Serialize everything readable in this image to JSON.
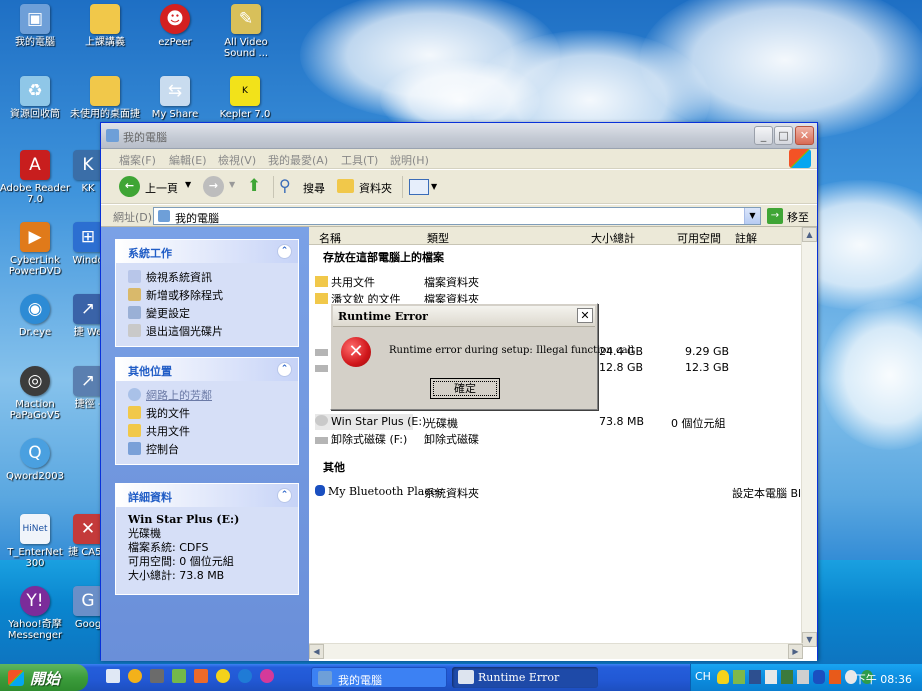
{
  "desktop": {
    "icons": [
      {
        "label": "我的電腦",
        "icon": "my-computer-icon"
      },
      {
        "label": "上課講義",
        "icon": "folder-icon"
      },
      {
        "label": "ezPeer",
        "icon": "ezpeer-icon"
      },
      {
        "label": "All Video Sound ...",
        "icon": "paint-brush-icon"
      },
      {
        "label": "資源回收筒",
        "icon": "recycle-bin-icon"
      },
      {
        "label": "未使用的桌面捷",
        "icon": "folder-icon"
      },
      {
        "label": "My Share",
        "icon": "my-share-icon"
      },
      {
        "label": "Kepler 7.0",
        "icon": "kepler-icon"
      },
      {
        "label": "Adobe Reader 7.0",
        "icon": "adobe-reader-icon"
      },
      {
        "label": "KK",
        "icon": "kk-icon"
      },
      {
        "label": "CyberLink PowerDVD",
        "icon": "powerdvd-icon"
      },
      {
        "label": "Windo",
        "icon": "windows-icon"
      },
      {
        "label": "Dr.eye",
        "icon": "dreye-icon"
      },
      {
        "label": "捷 We",
        "icon": "shortcut-icon"
      },
      {
        "label": "Maction PaPaGoV5",
        "icon": "papago-icon"
      },
      {
        "label": "捷徑 -",
        "icon": "shortcut-icon"
      },
      {
        "label": "Qword2003",
        "icon": "qword-icon"
      },
      {
        "label": "T_EnterNet 300",
        "icon": "hinet-icon"
      },
      {
        "label": "捷 CA54",
        "icon": "shortcut-icon"
      },
      {
        "label": "Yahoo!奇摩 Messenger",
        "icon": "yahoo-messenger-icon"
      },
      {
        "label": "Goog",
        "icon": "google-icon"
      }
    ]
  },
  "window": {
    "title": "我的電腦",
    "menu": [
      "檔案(F)",
      "編輯(E)",
      "檢視(V)",
      "我的最愛(A)",
      "工具(T)",
      "說明(H)"
    ],
    "toolbar": {
      "back": "上一頁",
      "search": "搜尋",
      "folders": "資料夾"
    },
    "address": {
      "label": "網址(D)",
      "value": "我的電腦",
      "go": "移至"
    },
    "tasks": {
      "system": {
        "title": "系統工作",
        "items": [
          "檢視系統資訊",
          "新增或移除程式",
          "變更設定",
          "退出這個光碟片"
        ]
      },
      "other": {
        "title": "其他位置",
        "items": [
          "網路上的芳鄰",
          "我的文件",
          "共用文件",
          "控制台"
        ]
      },
      "details": {
        "title": "詳細資料",
        "name": "Win Star Plus (E:)",
        "type": "光碟機",
        "fs": "檔案系統: CDFS",
        "free": "可用空間: 0 個位元組",
        "total": "大小總計: 73.8 MB"
      }
    },
    "columns": [
      "名稱",
      "類型",
      "大小總計",
      "可用空間",
      "註解"
    ],
    "groups": {
      "stored": "存放在這部電腦上的檔案",
      "other": "其他"
    },
    "files": [
      {
        "name": "共用文件",
        "type": "檔案資料夾"
      },
      {
        "name": "潘文欽 的文件",
        "type": "檔案資料夾"
      }
    ],
    "drives": [
      {
        "total": "24.4 GB",
        "free": "9.29 GB"
      },
      {
        "total": "12.8 GB",
        "free": "12.3 GB"
      }
    ],
    "removable": [
      {
        "name": "Win Star Plus (E:)",
        "type": "光碟機",
        "total": "73.8 MB",
        "free": "0 個位元組"
      },
      {
        "name": "卸除式磁碟 (F:)",
        "type": "卸除式磁碟"
      }
    ],
    "other_items": [
      {
        "name": "My Bluetooth Places",
        "type": "系統資料夾",
        "comment": "設定本電腦 Blueto"
      }
    ]
  },
  "dialog": {
    "title": "Runtime Error",
    "message": "Runtime error during setup: Illegal function call",
    "ok": "確定"
  },
  "taskbar": {
    "start": "開始",
    "tasks": [
      "我的電腦",
      "Runtime Error"
    ],
    "lang": "CH",
    "clock": "下午 08:36"
  },
  "colors": {
    "accent": "#215dc6",
    "taskbar": "#245edb",
    "error": "#d0171b"
  }
}
